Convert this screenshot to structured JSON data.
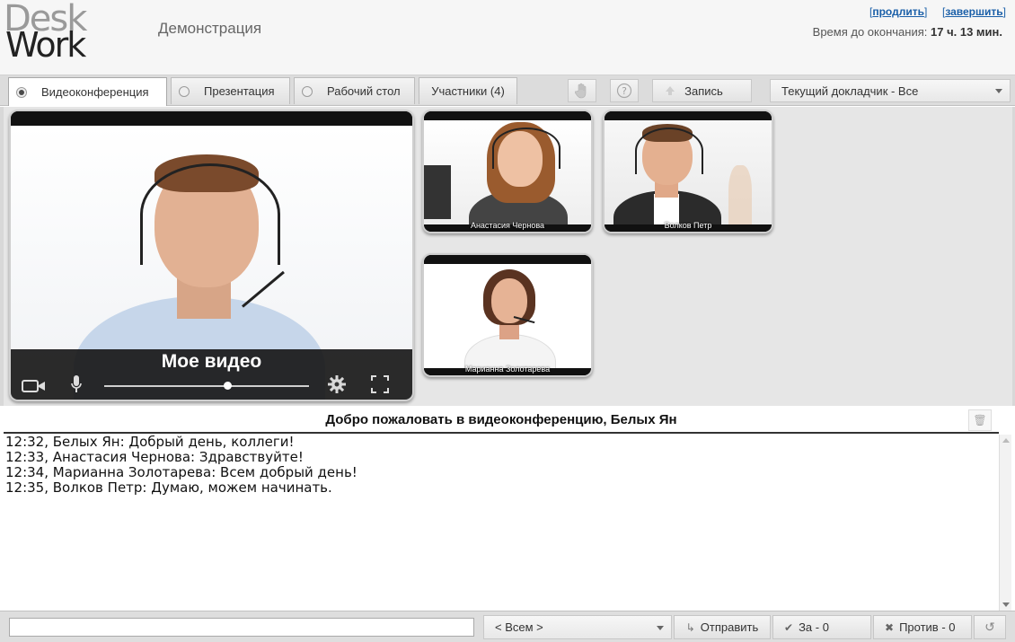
{
  "header": {
    "logo_line1": "Desk",
    "logo_line2": "Work",
    "title": "Демонстрация",
    "link_extend": "продлить",
    "link_finish": "завершить",
    "timer_label": "Время до окончания:",
    "timer_value": "17 ч. 13 мин."
  },
  "toolbar": {
    "tabs": [
      {
        "label": "Видеоконференция",
        "active": true
      },
      {
        "label": "Презентация",
        "active": false
      },
      {
        "label": "Рабочий стол",
        "active": false
      }
    ],
    "participants_tab": "Участники (4)",
    "hand_icon": "hand-icon",
    "help_icon": "help-icon",
    "record_label": "Запись",
    "speaker_select": "Текущий докладчик - Все"
  },
  "videos": {
    "main_label": "Мое видео",
    "tiles": [
      {
        "name": "Анастасия Чернова"
      },
      {
        "name": "Волков Петр"
      },
      {
        "name": "Марианна Золотарева"
      }
    ],
    "volume_level": 0.6
  },
  "chat": {
    "title": "Добро пожаловать в видеоконференцию, Белых Ян",
    "messages": [
      "12:32, Белых Ян: Добрый день, коллеги!",
      "12:33, Анастасия Чернова: Здравствуйте!",
      "12:34, Марианна Золотарева: Всем добрый день!",
      "12:35, Волков Петр: Думаю, можем начинать."
    ]
  },
  "bottom": {
    "input_value": "",
    "recipient_select": "< Всем >",
    "send_label": "Отправить",
    "vote_for": "За - 0",
    "vote_against": "Против - 0"
  },
  "colors": {
    "link": "#1a5fa8",
    "video_frame": "#111111",
    "toolbar_bg": "#dcdcdc"
  }
}
